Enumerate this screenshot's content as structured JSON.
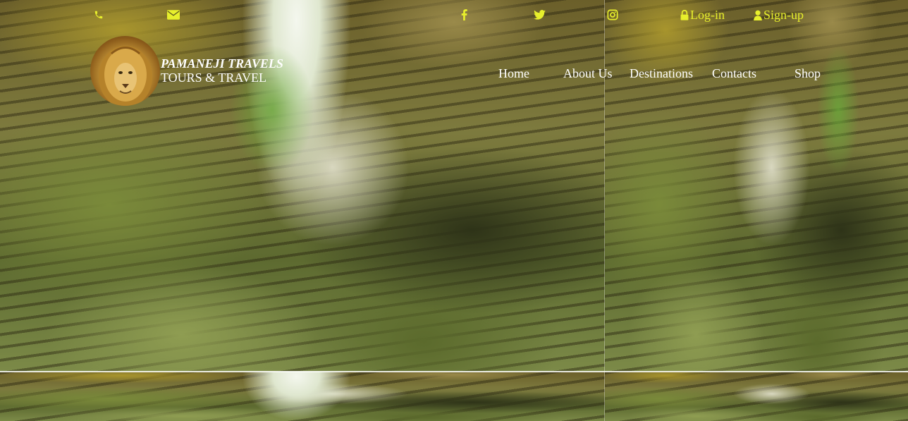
{
  "colors": {
    "accent": "#e7ef2c",
    "nav_text": "#ffffff"
  },
  "topbar": {
    "phone_icon": "phone-icon",
    "email_icon": "envelope-icon",
    "facebook_icon": "facebook-icon",
    "twitter_icon": "twitter-icon",
    "instagram_icon": "instagram-icon",
    "login_label": "Log-in",
    "signup_label": "Sign-up"
  },
  "brand": {
    "name": "PAMANEJI TRAVELS",
    "tagline": "TOURS & TRAVEL",
    "logo": "lion-logo"
  },
  "nav": {
    "home": "Home",
    "about": "About Us",
    "destinations": "Destinations",
    "contacts": "Contacts",
    "shop": "Shop"
  }
}
